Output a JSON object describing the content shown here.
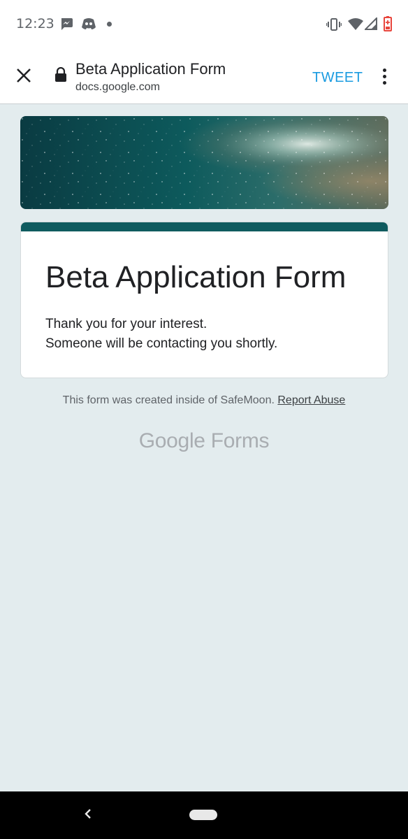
{
  "status_bar": {
    "time": "12:23",
    "notification_icons": [
      "messenger-icon",
      "discord-icon",
      "more-dot-icon"
    ],
    "system_icons": [
      "vibrate-icon",
      "wifi-icon",
      "signal-icon",
      "battery-low-icon"
    ]
  },
  "toolbar": {
    "title": "Beta Application Form",
    "url": "docs.google.com",
    "action_label": "TWEET",
    "close_icon": "close-icon",
    "lock_icon": "lock-icon",
    "menu_icon": "more-vert-icon"
  },
  "form": {
    "title": "Beta Application Form",
    "message_line1": "Thank you for your interest.",
    "message_line2": "Someone will be contacting you shortly.",
    "accent_color": "#0f5b5f"
  },
  "footer": {
    "note": "This form was created inside of SafeMoon.",
    "report_label": "Report Abuse",
    "logo_google": "Google",
    "logo_forms": "Forms"
  },
  "colors": {
    "page_background": "#e3ecee",
    "link_blue": "#1a9be0"
  }
}
